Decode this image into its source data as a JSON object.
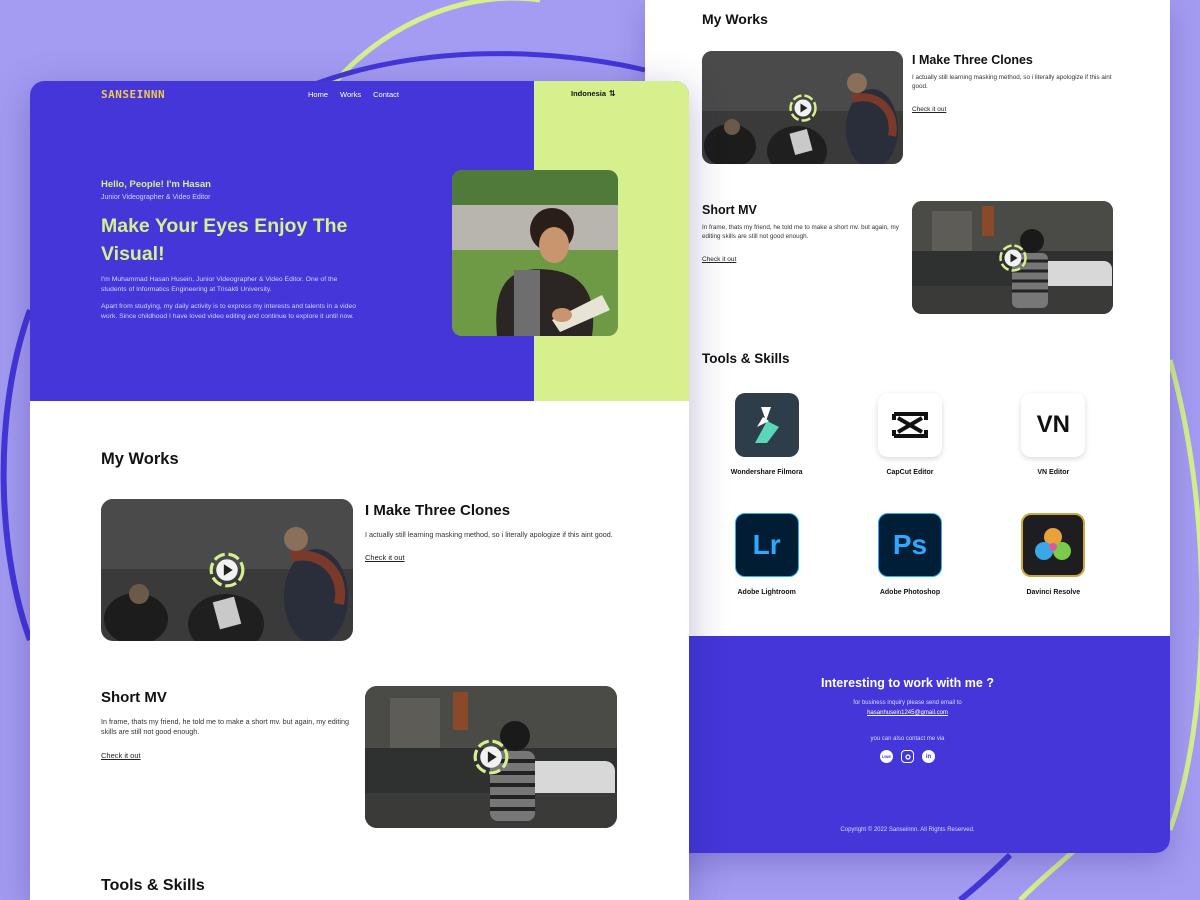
{
  "colors": {
    "background": "#a49cf2",
    "accent_purple": "#4436d8",
    "accent_lime": "#d5f08d",
    "logo_yellow": "#f2c94c"
  },
  "header": {
    "logo": "SANSEINNN",
    "nav": [
      "Home",
      "Works",
      "Contact"
    ],
    "language": "Indonesia"
  },
  "hero": {
    "greeting": "Hello, People! I'm Hasan",
    "role": "Junior Videographer & Video Editor",
    "headline": "Make Your Eyes Enjoy The Visual!",
    "para1": "I'm Muhammad Hasan Husein, Junior Videographer & Video Editor. One of the students of Informatics Engineering at Trisakti University.",
    "para2": "Apart from studying, my daily activity is to express my interests and talents in a video work. Since childhood I have loved video editing and continue to explore it until now."
  },
  "works": {
    "title": "My Works",
    "items": [
      {
        "title": "I Make Three Clones",
        "desc": "I actually still learning masking method, so i literally apologize if this aint good.",
        "link": "Check it out"
      },
      {
        "title": "Short MV",
        "desc": "In frame, thats my friend, he told me to make a short mv. but again, my editing skills are still not good enough.",
        "link": "Check it out"
      }
    ]
  },
  "tools": {
    "title": "Tools & Skills",
    "items": [
      {
        "name": "Wondershare Filmora",
        "icon": "filmora-icon"
      },
      {
        "name": "CapCut Editor",
        "icon": "capcut-icon"
      },
      {
        "name": "VN Editor",
        "icon": "vn-icon"
      },
      {
        "name": "Adobe Lightroom",
        "icon": "lightroom-icon"
      },
      {
        "name": "Adobe Photoshop",
        "icon": "photoshop-icon"
      },
      {
        "name": "Davinci Resolve",
        "icon": "davinci-icon"
      }
    ]
  },
  "contact": {
    "title": "Interesting to work with me ?",
    "business": "for business inquiry please send email to",
    "email": "hasanhusein1245@gmail.com",
    "via": "you can also contact me via",
    "socials": [
      "line-icon",
      "instagram-icon",
      "linkedin-icon"
    ],
    "copyright": "Copyright © 2022 Sanseinnn. All Rights Reserved."
  },
  "icon_glyphs": {
    "vn": "VN",
    "lightroom": "Lr",
    "photoshop": "Ps",
    "line": "LINE",
    "linkedin": "in"
  }
}
